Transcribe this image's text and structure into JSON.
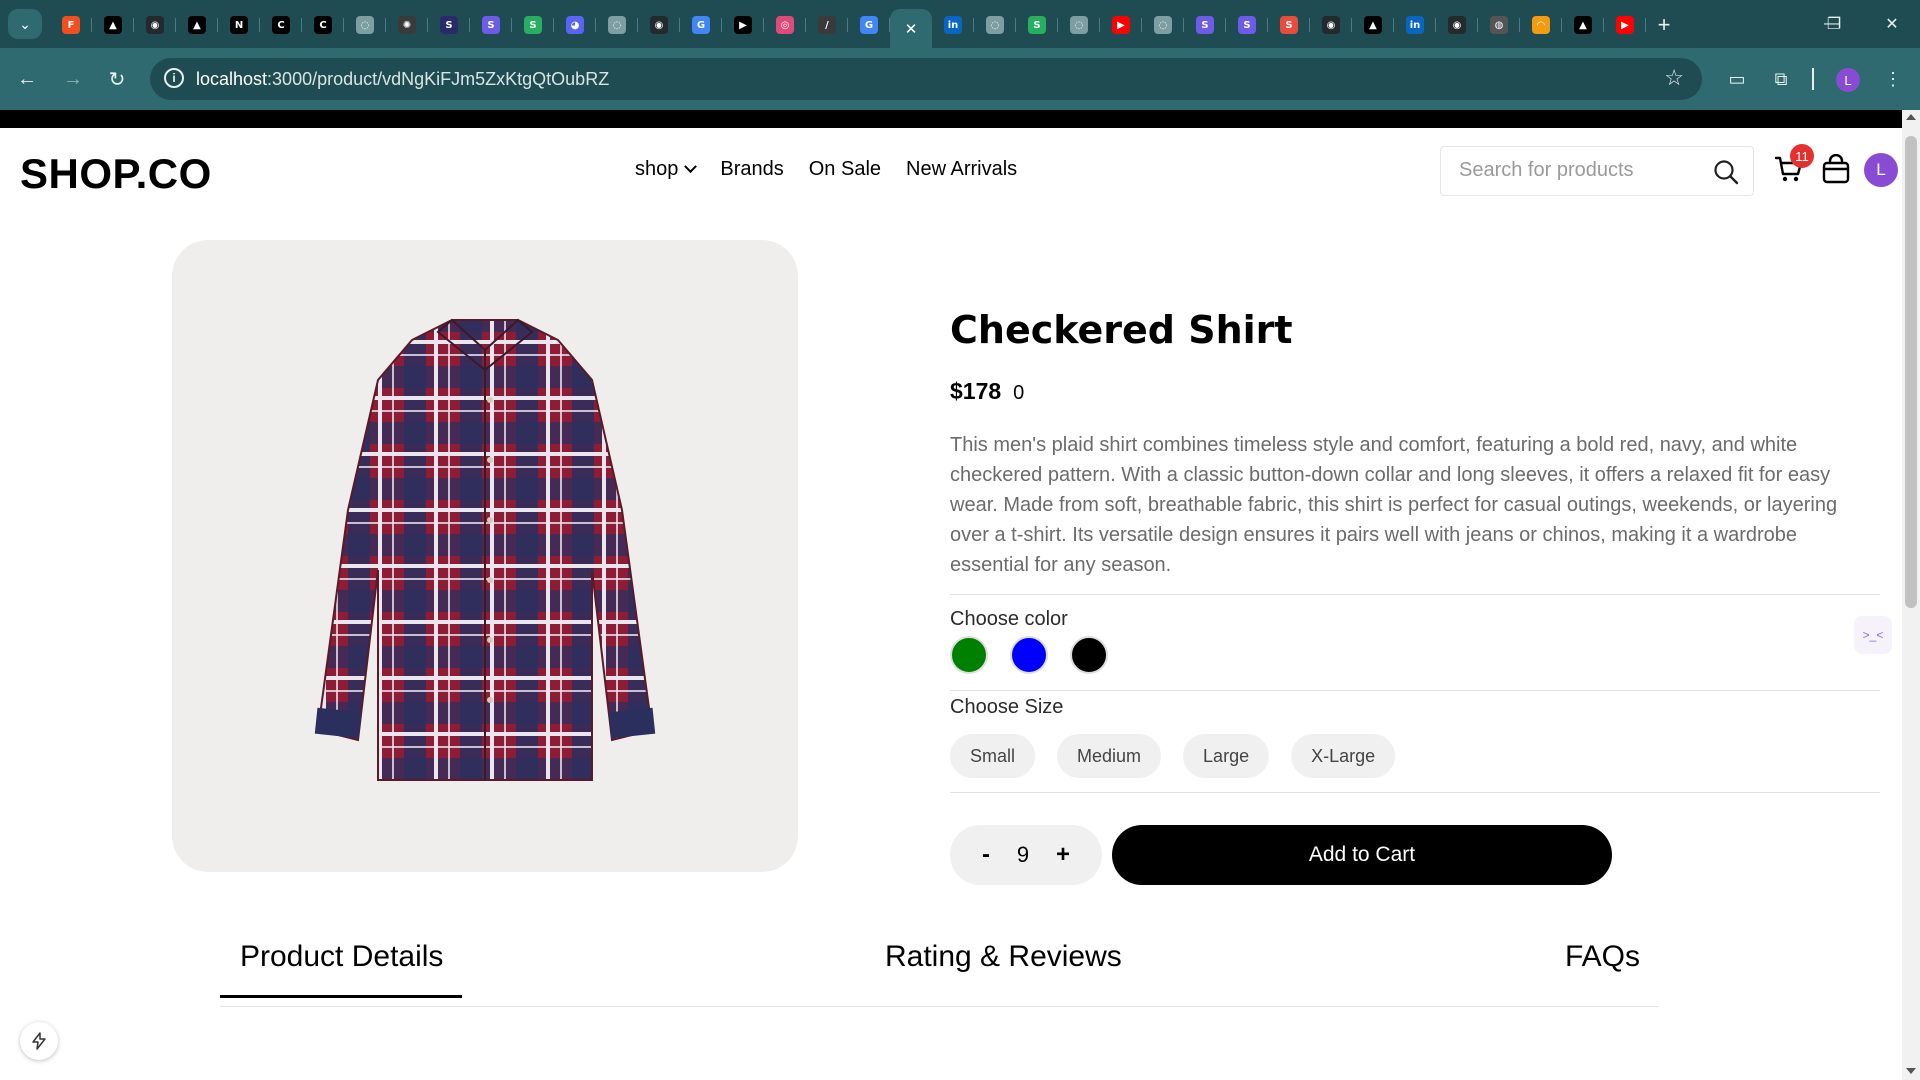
{
  "browser": {
    "favicons": [
      {
        "icon": "figma-icon",
        "color": "#f24e1e",
        "glyph": "F"
      },
      {
        "icon": "triangle-icon",
        "color": "#000000",
        "glyph": "▲"
      },
      {
        "icon": "github-icon",
        "color": "#24292e",
        "glyph": "◉"
      },
      {
        "icon": "triangle-icon",
        "color": "#000000",
        "glyph": "▲"
      },
      {
        "icon": "notion-icon",
        "color": "#000000",
        "glyph": "N"
      },
      {
        "icon": "c-logo-icon",
        "color": "#000000",
        "glyph": "C"
      },
      {
        "icon": "c-logo-icon",
        "color": "#000000",
        "glyph": "C"
      },
      {
        "icon": "globe-icon",
        "color": "#7d9ea2",
        "glyph": "◌"
      },
      {
        "icon": "openai-icon",
        "color": "#3a3a3a",
        "glyph": "✺"
      },
      {
        "icon": "s-logo-icon",
        "color": "#2a2a6a",
        "glyph": "S"
      },
      {
        "icon": "s-logo-icon",
        "color": "#6c5ce7",
        "glyph": "S"
      },
      {
        "icon": "s-logo-icon",
        "color": "#27ae60",
        "glyph": "S"
      },
      {
        "icon": "discord-icon",
        "color": "#5865f2",
        "glyph": "◕"
      },
      {
        "icon": "globe-icon",
        "color": "#7d9ea2",
        "glyph": "◌"
      },
      {
        "icon": "github-icon",
        "color": "#24292e",
        "glyph": "◉"
      },
      {
        "icon": "google-icon",
        "color": "#4285f4",
        "glyph": "G"
      },
      {
        "icon": "vercel-icon",
        "color": "#000000",
        "glyph": "▶"
      },
      {
        "icon": "swirl-icon",
        "color": "#e04a7a",
        "glyph": "◎"
      },
      {
        "icon": "pen-icon",
        "color": "#3a3a3a",
        "glyph": "/"
      },
      {
        "icon": "google-icon",
        "color": "#4285f4",
        "glyph": "G"
      }
    ],
    "favicons_right": [
      {
        "icon": "linkedin-icon",
        "color": "#0a66c2",
        "glyph": "in"
      },
      {
        "icon": "globe-icon",
        "color": "#7d9ea2",
        "glyph": "◌"
      },
      {
        "icon": "s-logo-icon",
        "color": "#27ae60",
        "glyph": "S"
      },
      {
        "icon": "globe-icon",
        "color": "#7d9ea2",
        "glyph": "◌"
      },
      {
        "icon": "youtube-icon",
        "color": "#ff0000",
        "glyph": "▶"
      },
      {
        "icon": "globe-icon",
        "color": "#7d9ea2",
        "glyph": "◌"
      },
      {
        "icon": "s-logo-icon",
        "color": "#6c5ce7",
        "glyph": "S"
      },
      {
        "icon": "s-logo-icon",
        "color": "#6c5ce7",
        "glyph": "S"
      },
      {
        "icon": "s-logo-icon",
        "color": "#e74c3c",
        "glyph": "S"
      },
      {
        "icon": "github-icon",
        "color": "#24292e",
        "glyph": "◉"
      },
      {
        "icon": "triangle-icon",
        "color": "#000000",
        "glyph": "▲"
      },
      {
        "icon": "linkedin-icon",
        "color": "#0a66c2",
        "glyph": "in"
      },
      {
        "icon": "github-icon",
        "color": "#24292e",
        "glyph": "◉"
      },
      {
        "icon": "globe-icon",
        "color": "#555555",
        "glyph": "◍"
      },
      {
        "icon": "rainbow-icon",
        "color": "#f39c12",
        "glyph": "◠"
      },
      {
        "icon": "triangle-icon",
        "color": "#000000",
        "glyph": "▲"
      },
      {
        "icon": "youtube-icon",
        "color": "#ff0000",
        "glyph": "▶"
      }
    ],
    "active_tab_close": "✕",
    "new_tab": "+",
    "window_controls": {
      "minimize": "—",
      "restore": "❐",
      "close": "✕"
    },
    "url_host": "localhost",
    "url_rest": ":3000/product/vdNgKiFJm5ZxKtgQtOubRZ",
    "profile_initial": "L"
  },
  "header": {
    "logo": "SHOP.CO",
    "nav": {
      "shop": "shop",
      "brands": "Brands",
      "on_sale": "On Sale",
      "new_arrivals": "New Arrivals"
    },
    "search_placeholder": "Search for products",
    "cart_count": "11",
    "avatar_initial": "L"
  },
  "product": {
    "title": "Checkered Shirt",
    "price": "$178",
    "price_extra": "0",
    "description": "This men's plaid shirt combines timeless style and comfort, featuring a bold red, navy, and white checkered pattern. With a classic button-down collar and long sleeves, it offers a relaxed fit for easy wear. Made from soft, breathable fabric, this shirt is perfect for casual outings, weekends, or layering over a t-shirt. Its versatile design ensures it pairs well with jeans or chinos, making it a wardrobe essential for any season.",
    "choose_color_label": "Choose color",
    "colors": [
      "#008000",
      "#0000ff",
      "#000000"
    ],
    "choose_size_label": "Choose Size",
    "sizes": [
      "Small",
      "Medium",
      "Large",
      "X-Large"
    ],
    "quantity": "9",
    "qty_minus": "-",
    "qty_plus": "+",
    "add_to_cart": "Add to Cart"
  },
  "tabs": {
    "details": "Product Details",
    "reviews": "Rating & Reviews",
    "faqs": "FAQs"
  },
  "widgets": {
    "side_widget_glyph": ">_<"
  }
}
